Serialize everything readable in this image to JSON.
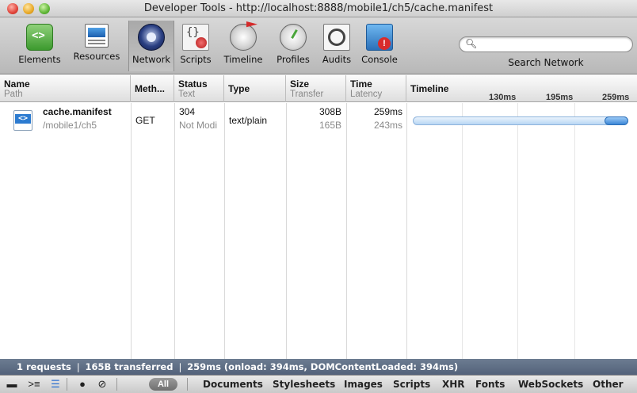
{
  "window": {
    "title": "Developer Tools - http://localhost:8888/mobile1/ch5/cache.manifest"
  },
  "toolbar": {
    "items": [
      {
        "label": "Elements",
        "icon": "elements-icon"
      },
      {
        "label": "Resources",
        "icon": "resources-icon"
      },
      {
        "label": "Network",
        "icon": "network-icon",
        "active": true
      },
      {
        "label": "Scripts",
        "icon": "scripts-icon"
      },
      {
        "label": "Timeline",
        "icon": "timeline-icon"
      },
      {
        "label": "Profiles",
        "icon": "profiles-icon"
      },
      {
        "label": "Audits",
        "icon": "audits-icon"
      },
      {
        "label": "Console",
        "icon": "console-icon"
      }
    ],
    "search": {
      "value": "",
      "label": "Search Network"
    }
  },
  "grid": {
    "headers": {
      "name": {
        "top": "Name",
        "sub": "Path"
      },
      "method": {
        "top": "Meth..."
      },
      "status": {
        "top": "Status",
        "sub": "Text"
      },
      "type": {
        "top": "Type"
      },
      "size": {
        "top": "Size",
        "sub": "Transfer"
      },
      "time": {
        "top": "Time",
        "sub": "Latency"
      },
      "timeline": {
        "top": "Timeline"
      },
      "ticks": [
        "130ms",
        "195ms",
        "259ms"
      ]
    },
    "rows": [
      {
        "name": "cache.manifest",
        "path": "/mobile1/ch5",
        "method": "GET",
        "status": "304",
        "status_text": "Not Modi",
        "type": "text/plain",
        "size": "308B",
        "transfer": "165B",
        "time": "259ms",
        "latency": "243ms"
      }
    ]
  },
  "statusbar": {
    "text": "1 requests  ❘  165B transferred  ❘  259ms (onload: 394ms, DOMContentLoaded: 394ms)"
  },
  "bottombar": {
    "all_label": "All",
    "filters": [
      "Documents",
      "Stylesheets",
      "Images",
      "Scripts",
      "XHR",
      "Fonts",
      "WebSockets",
      "Other"
    ]
  }
}
